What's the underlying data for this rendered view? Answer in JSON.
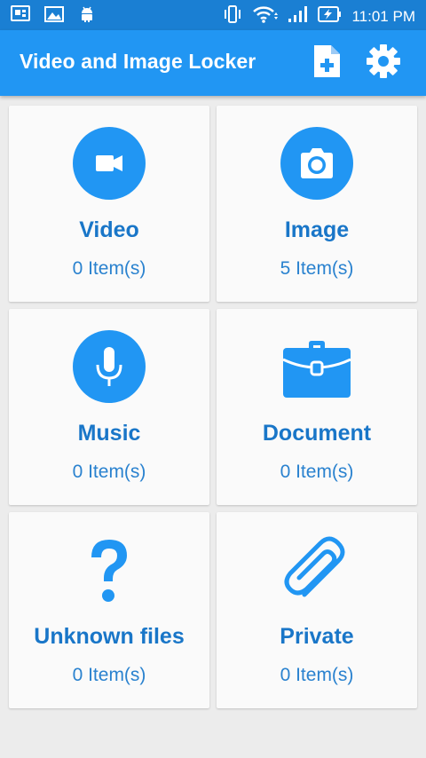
{
  "status_bar": {
    "time": "11:01 PM",
    "left_icons": [
      "screen-cast-icon",
      "image-icon",
      "android-icon"
    ],
    "right_icons": [
      "vibrate-icon",
      "wifi-icon",
      "signal-icon",
      "battery-charging-icon"
    ]
  },
  "app_bar": {
    "title": "Video and Image Locker",
    "actions": [
      "add-file-icon",
      "settings-gear-icon"
    ]
  },
  "categories": [
    {
      "title": "Video",
      "count": "0 Item(s)",
      "icon": "video-camera-icon"
    },
    {
      "title": "Image",
      "count": "5 Item(s)",
      "icon": "camera-icon"
    },
    {
      "title": "Music",
      "count": "0 Item(s)",
      "icon": "microphone-icon"
    },
    {
      "title": "Document",
      "count": "0 Item(s)",
      "icon": "briefcase-icon"
    },
    {
      "title": "Unknown files",
      "count": "0 Item(s)",
      "icon": "question-mark-icon"
    },
    {
      "title": "Private",
      "count": "0 Item(s)",
      "icon": "paperclip-icon"
    }
  ],
  "colors": {
    "status_bar": "#1a7fd3",
    "app_bar": "#2196f3",
    "accent": "#2196f3",
    "title_text": "#1976c8",
    "background": "#ececec",
    "card": "#fafafa"
  }
}
